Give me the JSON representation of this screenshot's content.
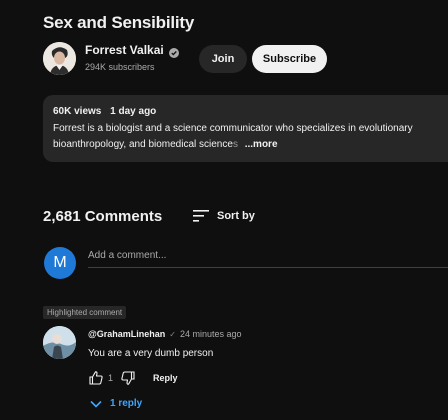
{
  "video": {
    "title": "Sex and Sensibility",
    "views": "60K views",
    "age": "1 day ago",
    "description_line1": "Forrest is a biologist and a science communicator who specializes in evolutionary",
    "description_line2_visible": "bioanthropology, and biomedical science",
    "description_line2_fade": "s",
    "more_label": "...more"
  },
  "channel": {
    "name": "Forrest Valkai",
    "subscribers": "294K subscribers",
    "verified_icon": "verified-check-icon",
    "join_label": "Join",
    "subscribe_label": "Subscribe"
  },
  "comments": {
    "count_label": "2,681 Comments",
    "sort_label": "Sort by",
    "add_placeholder": "Add a comment...",
    "user_avatar_letter": "M",
    "user_avatar_color": "#1f79d6",
    "highlighted_badge": "Highlighted comment",
    "items": [
      {
        "author": "@GrahamLinehan",
        "author_mark": "✓",
        "time": "24 minutes ago",
        "text": "You are a very dumb person",
        "likes": "1",
        "reply_label": "Reply",
        "replies_label": "1 reply"
      }
    ]
  },
  "colors": {
    "background": "#0f0f0f",
    "surface": "#272727",
    "link_blue": "#3ea6ff",
    "text_primary": "#f1f1f1",
    "text_secondary": "#aaaaaa"
  }
}
